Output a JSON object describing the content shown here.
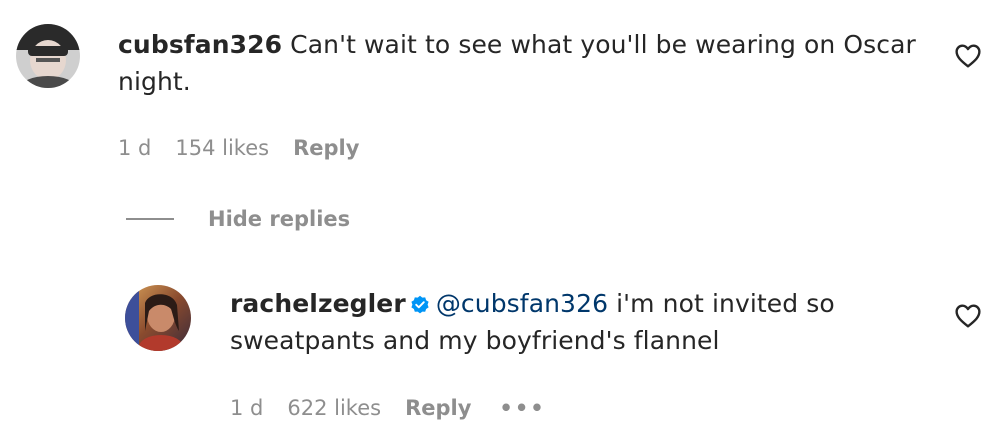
{
  "comment": {
    "username": "cubsfan326",
    "text": "Can't wait to see what you'll be wearing on Oscar night.",
    "time": "1 d",
    "likes": "154 likes",
    "reply_label": "Reply"
  },
  "hide_replies_label": "Hide replies",
  "reply": {
    "username": "rachelzegler",
    "mention": "@cubsfan326",
    "text": "i'm not invited so sweatpants and my boyfriend's flannel",
    "time": "1 d",
    "likes": "622 likes",
    "reply_label": "Reply",
    "more_label": "•••"
  },
  "colors": {
    "text": "#262626",
    "secondary": "#8e8e8e",
    "mention": "#00376b",
    "verified": "#0095f6"
  }
}
